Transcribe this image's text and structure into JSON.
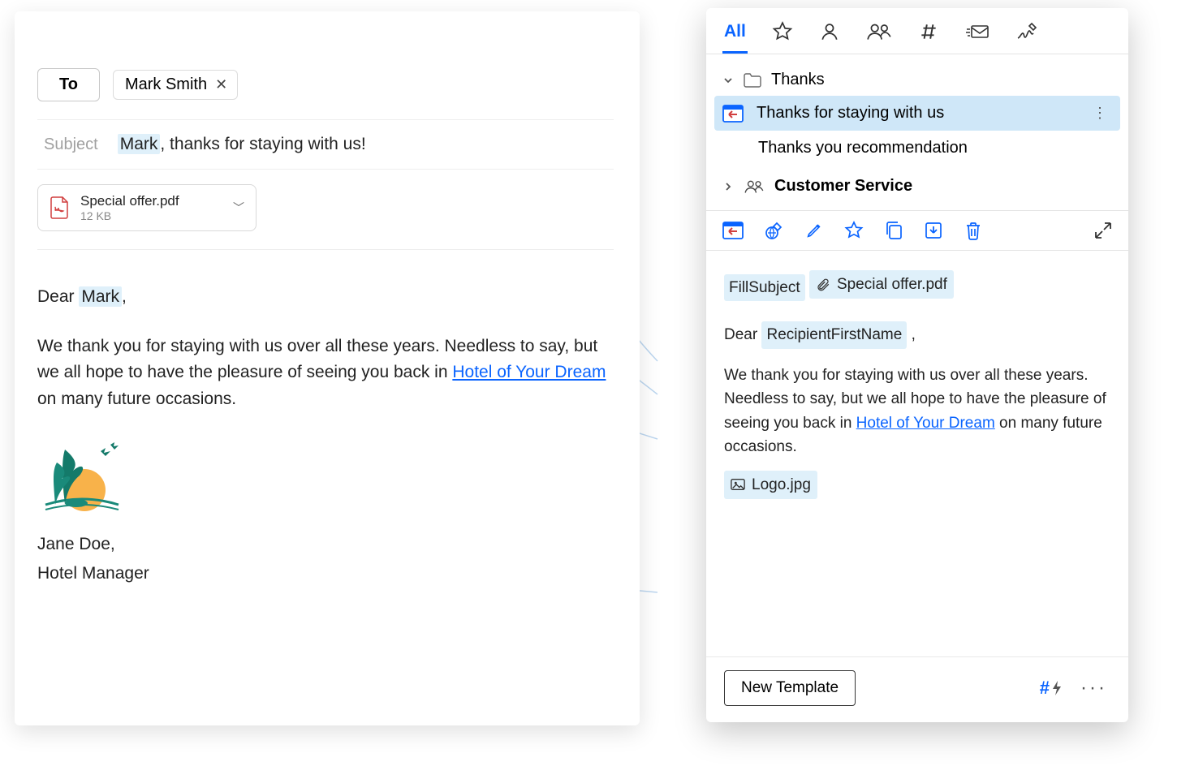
{
  "compose": {
    "to_label": "To",
    "recipient": "Mark Smith",
    "subject_label": "Subject",
    "subject_hl": "Mark",
    "subject_rest": ", thanks for staying with us!",
    "attachment": {
      "name": "Special offer.pdf",
      "size": "12 KB"
    },
    "greeting_prefix": "Dear ",
    "greeting_hl": "Mark",
    "greeting_suffix": ",",
    "para1a": "We thank you for staying with us over all these years. Needless to say, but we all hope to have the pleasure of seeing you back in ",
    "link": "Hotel of Your Dream",
    "para1b": " on many future occasions.",
    "sig_name": "Jane Doe,",
    "sig_title": "Hotel Manager"
  },
  "panel": {
    "tab_all": "All",
    "folder1": "Thanks",
    "template_selected": "Thanks for staying with us",
    "template2": "Thanks you recommendation",
    "folder2": "Customer Service",
    "preview": {
      "fillsubject": "FillSubject",
      "attach": "Special offer.pdf",
      "dear": "Dear",
      "recip_tag": "RecipientFirstName",
      "comma": ",",
      "body_a": "We thank you for staying with us over all these years. Needless to say, but we all hope to have the pleasure of seeing you back in ",
      "link": "Hotel of Your Dream",
      "body_b": " on many future occasions.",
      "logo": "Logo.jpg"
    },
    "new_template": "New Template"
  }
}
